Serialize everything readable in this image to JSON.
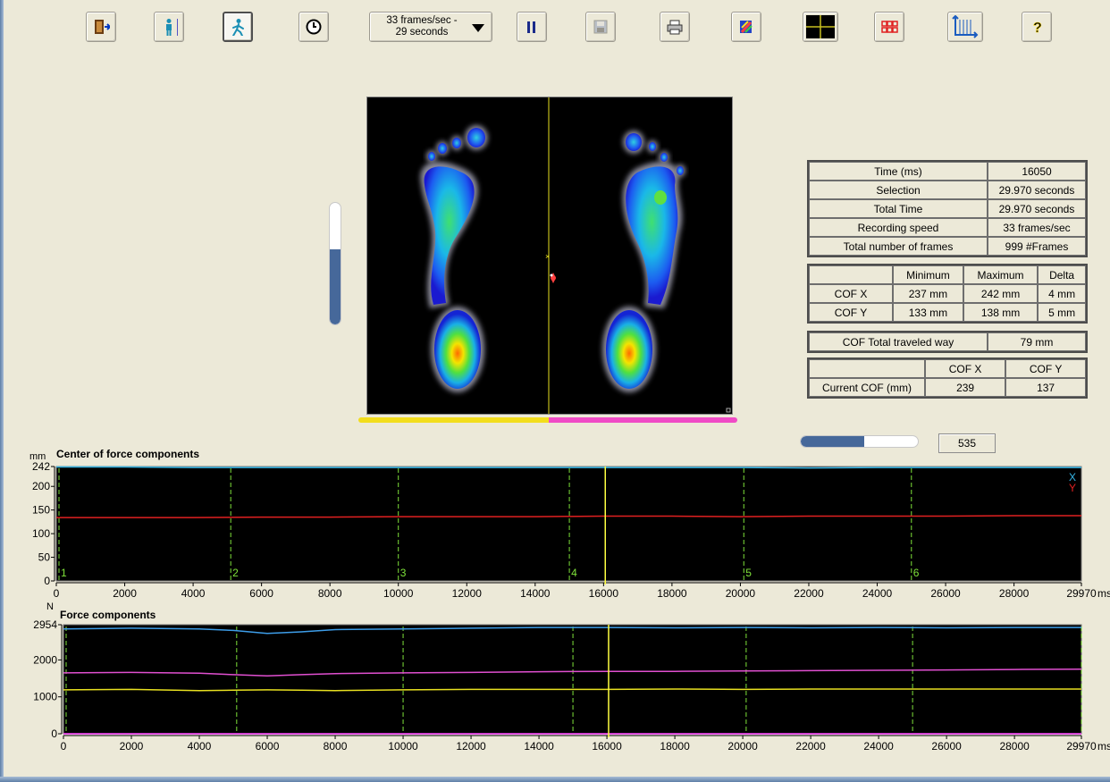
{
  "toolbar": {
    "buttons": [
      {
        "name": "exit-button",
        "icon": "exit-door-icon",
        "left": 96
      },
      {
        "name": "standing-mode-button",
        "icon": "standing-person-icon",
        "left": 172
      },
      {
        "name": "walking-mode-button",
        "icon": "walking-person-icon",
        "left": 249,
        "pressed": true
      },
      {
        "name": "timer-button",
        "icon": "clock-icon",
        "left": 334
      },
      {
        "name": "pause-button",
        "icon": "pause-icon",
        "left": 578
      },
      {
        "name": "save-button",
        "icon": "floppy-disk-icon",
        "left": 655,
        "disabled": true
      },
      {
        "name": "print-button",
        "icon": "printer-icon",
        "left": 738
      },
      {
        "name": "export-button",
        "icon": "export-arrows-icon",
        "left": 818
      },
      {
        "name": "cof-crosshair-button",
        "icon": "crosshair-icon",
        "left": 898
      },
      {
        "name": "grid-view-button",
        "icon": "grid-icon",
        "left": 978
      },
      {
        "name": "graph-settings-button",
        "icon": "axes-graph-icon",
        "left": 1060
      },
      {
        "name": "help-button",
        "icon": "help-icon",
        "left": 1143
      }
    ],
    "recording_select": {
      "line1": "33 frames/sec -",
      "line2": "29 seconds"
    }
  },
  "summary_table": [
    {
      "label": "Time (ms)",
      "value": "16050"
    },
    {
      "label": "Selection",
      "value": "29.970 seconds"
    },
    {
      "label": "Total Time",
      "value": "29.970 seconds"
    },
    {
      "label": "Recording speed",
      "value": "33 frames/sec"
    },
    {
      "label": "Total number of frames",
      "value": "999 #Frames"
    }
  ],
  "cof_range_table": {
    "headers": [
      "",
      "Minimum",
      "Maximum",
      "Delta"
    ],
    "rows": [
      [
        "COF X",
        "237 mm",
        "242 mm",
        "4 mm"
      ],
      [
        "COF Y",
        "133 mm",
        "138 mm",
        "5 mm"
      ]
    ]
  },
  "cof_total": {
    "label": "COF Total traveled way",
    "value": "79 mm"
  },
  "current_cof": {
    "headers": [
      "",
      "COF X",
      "COF Y"
    ],
    "label": "Current COF (mm)",
    "x": "239",
    "y": "137"
  },
  "sliders": {
    "vertical_level": 0.62,
    "horizontal_level": 0.54,
    "frame_number": "535"
  },
  "colors": {
    "x_series": "#35b6e6",
    "y_series": "#e02020",
    "left_foot_bar": "#f2dd1c",
    "right_foot_bar": "#f04bc6",
    "marker": "#ffff40",
    "step_lines": "#7fe23a"
  },
  "chart_data": [
    {
      "type": "line",
      "title": "Center of force components",
      "ylabel": "mm",
      "xlabel": "ms",
      "xlim": [
        0,
        29970
      ],
      "ylim": [
        0,
        242
      ],
      "x_ticks": [
        0,
        2000,
        4000,
        6000,
        8000,
        10000,
        12000,
        14000,
        16000,
        18000,
        20000,
        22000,
        24000,
        26000,
        28000,
        29970
      ],
      "y_ticks": [
        0,
        50,
        100,
        150,
        200,
        242
      ],
      "cursor_ms": 16050,
      "step_markers": [
        {
          "ms": 0,
          "label": "1"
        },
        {
          "ms": 5100,
          "label": "2"
        },
        {
          "ms": 10000,
          "label": "3"
        },
        {
          "ms": 15000,
          "label": "4"
        },
        {
          "ms": 20100,
          "label": "5"
        },
        {
          "ms": 25000,
          "label": "6"
        }
      ],
      "legend": [
        "X",
        "Y"
      ],
      "series": [
        {
          "name": "X",
          "color": "#35b6e6",
          "x": [
            0,
            2000,
            4000,
            6000,
            8000,
            10000,
            12000,
            14000,
            16000,
            18000,
            20000,
            22000,
            24000,
            26000,
            28000,
            29970
          ],
          "values": [
            241,
            241,
            240,
            240,
            240,
            240,
            240,
            240,
            240,
            240,
            240,
            239,
            240,
            240,
            240,
            240
          ]
        },
        {
          "name": "Y",
          "color": "#e02020",
          "x": [
            0,
            2000,
            4000,
            6000,
            8000,
            10000,
            12000,
            14000,
            16000,
            18000,
            20000,
            22000,
            24000,
            26000,
            28000,
            29970
          ],
          "values": [
            134,
            134,
            134,
            135,
            135,
            136,
            136,
            136,
            137,
            137,
            136,
            137,
            137,
            137,
            138,
            138
          ]
        }
      ]
    },
    {
      "type": "line",
      "title": "Force components",
      "ylabel": "N",
      "xlabel": "ms",
      "xlim": [
        0,
        29970
      ],
      "ylim": [
        0,
        2954
      ],
      "x_ticks": [
        0,
        2000,
        4000,
        6000,
        8000,
        10000,
        12000,
        14000,
        16000,
        18000,
        20000,
        22000,
        24000,
        26000,
        28000,
        29970
      ],
      "y_ticks": [
        0,
        1000,
        2000,
        2954
      ],
      "cursor_ms": 16050,
      "step_markers": [
        {
          "ms": 0,
          "label": ""
        },
        {
          "ms": 5100,
          "label": ""
        },
        {
          "ms": 10000,
          "label": ""
        },
        {
          "ms": 15000,
          "label": ""
        },
        {
          "ms": 20100,
          "label": ""
        },
        {
          "ms": 25000,
          "label": ""
        },
        {
          "ms": 29970,
          "label": ""
        }
      ],
      "series": [
        {
          "color": "#3d9de8",
          "x": [
            0,
            2000,
            4000,
            5000,
            6000,
            7000,
            8000,
            10000,
            12000,
            14000,
            16000,
            18000,
            20000,
            22000,
            24000,
            26000,
            28000,
            29970
          ],
          "values": [
            2840,
            2860,
            2840,
            2800,
            2720,
            2760,
            2820,
            2840,
            2860,
            2880,
            2880,
            2870,
            2880,
            2870,
            2880,
            2870,
            2880,
            2880
          ]
        },
        {
          "color": "#e04fd0",
          "x": [
            0,
            2000,
            4000,
            5000,
            6000,
            7000,
            8000,
            10000,
            12000,
            14000,
            16000,
            18000,
            20000,
            22000,
            24000,
            26000,
            28000,
            29970
          ],
          "values": [
            1650,
            1660,
            1640,
            1600,
            1570,
            1600,
            1630,
            1650,
            1660,
            1680,
            1690,
            1690,
            1700,
            1710,
            1720,
            1730,
            1740,
            1750
          ]
        },
        {
          "color": "#e8e020",
          "x": [
            0,
            2000,
            4000,
            5000,
            6000,
            7000,
            8000,
            10000,
            12000,
            14000,
            16000,
            18000,
            20000,
            22000,
            24000,
            26000,
            28000,
            29970
          ],
          "values": [
            1190,
            1200,
            1170,
            1180,
            1190,
            1180,
            1170,
            1190,
            1200,
            1200,
            1200,
            1210,
            1200,
            1210,
            1210,
            1210,
            1210,
            1210
          ]
        },
        {
          "color": "#ff40ff",
          "x": [
            0,
            29970
          ],
          "values": [
            0,
            0
          ]
        }
      ]
    }
  ]
}
